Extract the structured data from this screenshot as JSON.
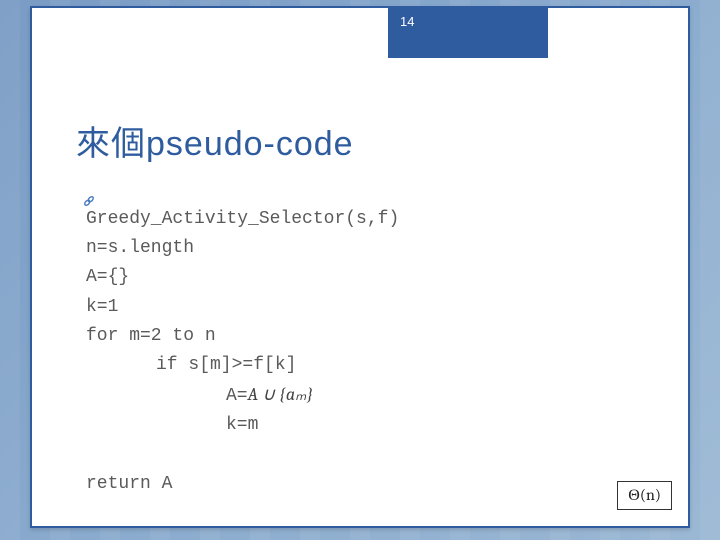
{
  "page_number": "14",
  "title": "來個pseudo-code",
  "code": {
    "l1": "Greedy_Activity_Selector(s,f)",
    "l2": "n=s.length",
    "l3": "A={}",
    "l4": "k=1",
    "l5": "for m=2 to n",
    "l6": "if s[m]>=f[k]",
    "l7_prefix": "A=",
    "l7_math": "A ∪ {aₘ}",
    "l8": "k=m",
    "l9": "return A"
  },
  "complexity": "Θ(n)",
  "icons": {
    "bullet": "link-icon"
  }
}
